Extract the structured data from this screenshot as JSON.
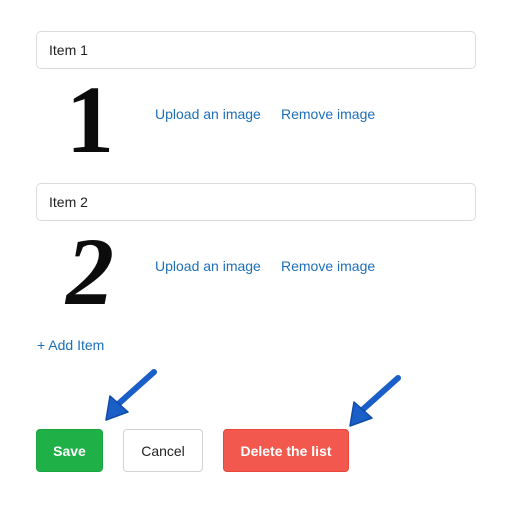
{
  "items": [
    {
      "value": "Item 1",
      "image_alt": "1",
      "upload_label": "Upload an image",
      "remove_label": "Remove image"
    },
    {
      "value": "Item 2",
      "image_alt": "2",
      "upload_label": "Upload an image",
      "remove_label": "Remove image"
    }
  ],
  "add_item_label": "+ Add Item",
  "buttons": {
    "save": "Save",
    "cancel": "Cancel",
    "delete": "Delete the list"
  },
  "colors": {
    "link": "#1d6fb8",
    "save": "#1fb148",
    "delete": "#f2584d",
    "annotation_arrow": "#1a5fc8"
  },
  "annotations": {
    "icon": "pointer-arrow-icon"
  }
}
